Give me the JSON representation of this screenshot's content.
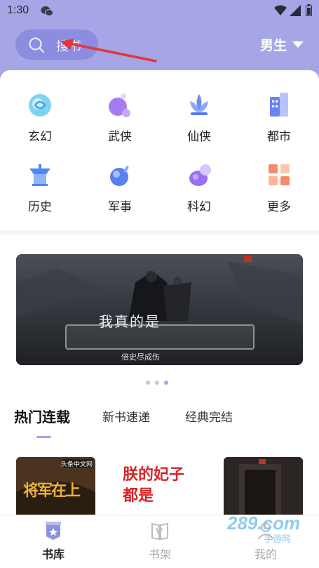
{
  "status": {
    "time": "1:30"
  },
  "header": {
    "search_placeholder": "搜书",
    "gender": "男生"
  },
  "categories": [
    {
      "label": "玄幻",
      "icon": "xuanhuan-icon"
    },
    {
      "label": "武侠",
      "icon": "wuxia-icon"
    },
    {
      "label": "仙侠",
      "icon": "xianxia-icon"
    },
    {
      "label": "都市",
      "icon": "dushi-icon"
    },
    {
      "label": "历史",
      "icon": "lishi-icon"
    },
    {
      "label": "军事",
      "icon": "junshi-icon"
    },
    {
      "label": "科幻",
      "icon": "kehuan-icon"
    },
    {
      "label": "更多",
      "icon": "more-grid-icon"
    }
  ],
  "banner": {
    "title": "我真的是",
    "subtitle": "倍史尽成伤",
    "slides": 3,
    "active_slide": 3
  },
  "tabs": [
    "热门连载",
    "新书速递",
    "经典完结"
  ],
  "books": [
    {
      "title": "将军在上",
      "badge": "头条中文网"
    },
    {
      "title": "朕的妃子都是",
      "badge": ""
    },
    {
      "title": "",
      "badge": ""
    }
  ],
  "nav": [
    {
      "label": "书库",
      "icon": "library-icon",
      "active": true
    },
    {
      "label": "书架",
      "icon": "bookshelf-icon",
      "active": false
    },
    {
      "label": "我的",
      "icon": "profile-icon",
      "active": false
    }
  ],
  "watermark": {
    "text": "289.com",
    "sub": "手游网"
  },
  "colors": {
    "accent": "#a6a6e6",
    "pill": "#8c8ce0",
    "indicator": "#9ea8e8"
  }
}
